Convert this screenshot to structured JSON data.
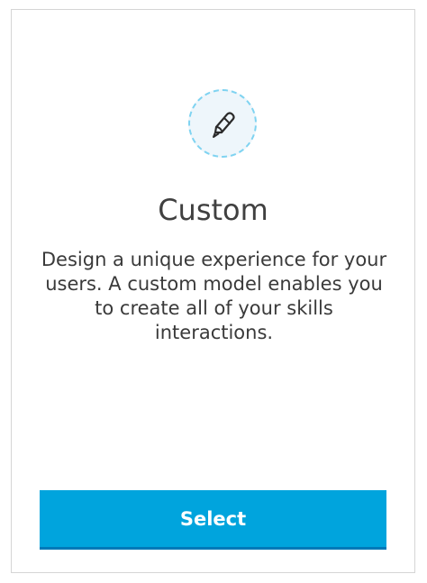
{
  "card": {
    "icon": "custom-model-pen-icon",
    "title": "Custom",
    "description": "Design a unique experience for your users. A custom model enables you to create all of your skills interactions.",
    "select_label": "Select"
  },
  "colors": {
    "accent": "#00a4dd",
    "accent_dark": "#0079b8",
    "icon_ring": "#7fd3f1",
    "icon_bg": "#eef6fb",
    "text": "#404040",
    "border": "#d5d5d5"
  }
}
